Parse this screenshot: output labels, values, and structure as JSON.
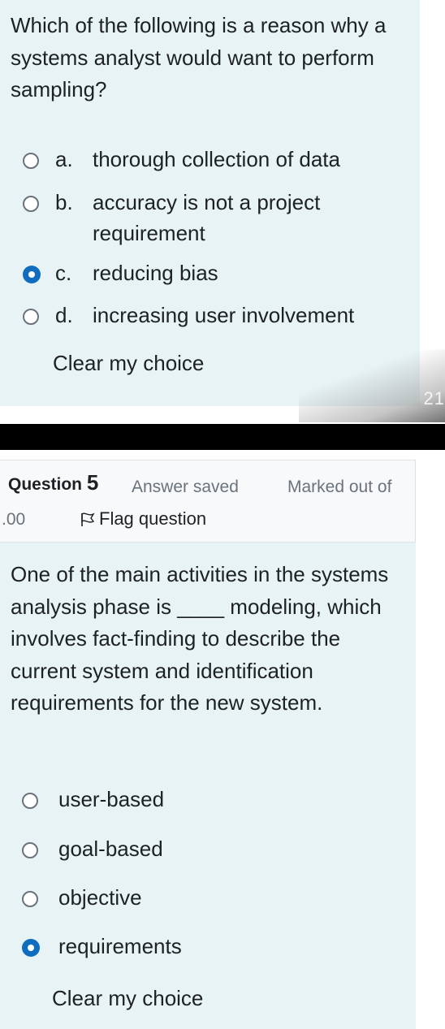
{
  "question_prev": {
    "text": "Which of the following is a reason why a systems analyst would want to perform sampling?",
    "options": [
      {
        "letter": "a.",
        "label": "thorough collection of data",
        "selected": false
      },
      {
        "letter": "b.",
        "label": "accuracy is not a project requirement",
        "selected": false
      },
      {
        "letter": "c.",
        "label": "reducing bias",
        "selected": true
      },
      {
        "letter": "d.",
        "label": "increasing user involvement",
        "selected": false
      }
    ],
    "clear_label": "Clear my choice"
  },
  "overlay_number": "21",
  "question5": {
    "title_prefix": "Question",
    "number": "5",
    "state": "Answer saved",
    "grade_prefix": "Marked out of",
    "grade_value": ".00",
    "flag_label": "Flag question",
    "text": "One of the main activities in the systems analysis phase is ____ modeling, which involves fact-finding to describe the current system and identification requirements for the new system.",
    "options": [
      {
        "label": "user-based",
        "selected": false
      },
      {
        "label": "goal-based",
        "selected": false
      },
      {
        "label": "objective",
        "selected": false
      },
      {
        "label": "requirements",
        "selected": true
      }
    ],
    "clear_label": "Clear my choice"
  },
  "colors": {
    "question_background": "#e7f3f5",
    "header_background": "#f8f9fa",
    "selected_radio": "#0f6cbf",
    "muted_text": "#6a737b"
  }
}
